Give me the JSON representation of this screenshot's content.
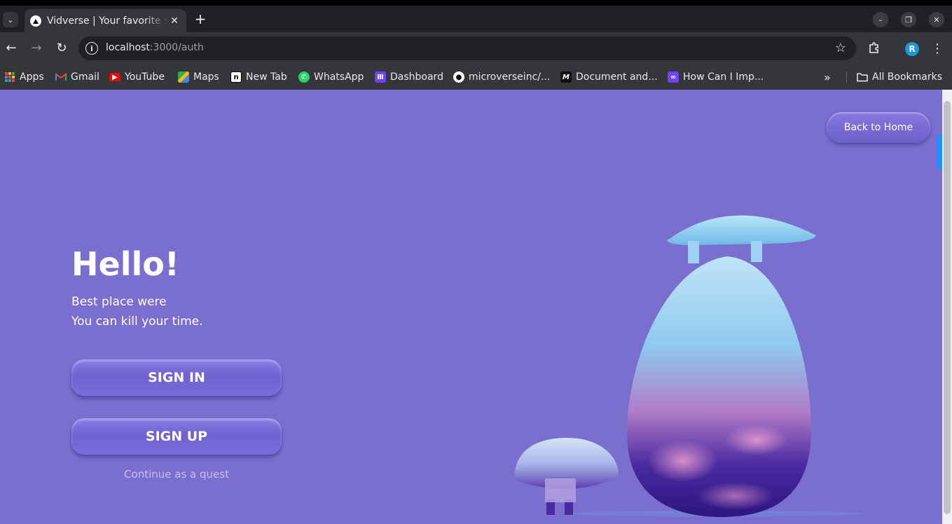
{
  "browser": {
    "tab": {
      "title": "Vidverse | Your favorite streaming platform"
    },
    "url": {
      "host": "localhost",
      "path": ":3000/auth"
    },
    "bookmarks": [
      {
        "label": "Apps",
        "icon": "apps-grid-icon"
      },
      {
        "label": "Gmail",
        "icon": "gmail-icon"
      },
      {
        "label": "YouTube",
        "icon": "youtube-icon"
      },
      {
        "label": "Maps",
        "icon": "maps-icon"
      },
      {
        "label": "New Tab",
        "icon": "notion-icon"
      },
      {
        "label": "WhatsApp",
        "icon": "whatsapp-icon"
      },
      {
        "label": "Dashboard",
        "icon": "dashboard-icon"
      },
      {
        "label": "microverseinc/...",
        "icon": "github-icon"
      },
      {
        "label": "Document and...",
        "icon": "document-icon"
      },
      {
        "label": "How Can I Imp...",
        "icon": "how-can-icon"
      }
    ],
    "all_bookmarks": "All Bookmarks",
    "profile_initial": "R"
  },
  "page": {
    "back_home": "Back to Home",
    "hello": "Hello!",
    "tagline_1": "Best place were",
    "tagline_2": "You can kill your time.",
    "sign_in": "SIGN IN",
    "sign_up": "SIGN UP",
    "guest": "Continue as a quest"
  },
  "colors": {
    "page_bg": "#7a6fcf",
    "button": "#7a6dda",
    "guest_link": "#cdbcf7"
  }
}
